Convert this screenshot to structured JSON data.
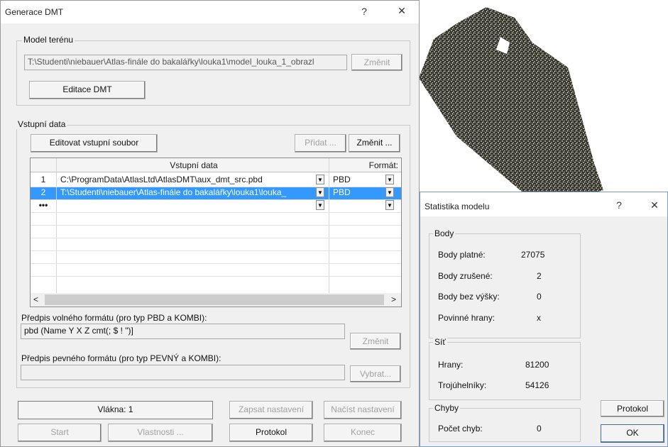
{
  "point_cloud": {
    "icon": "point-cloud-preview"
  },
  "generace": {
    "title": "Generace DMT",
    "help": "?",
    "close": "✕",
    "model_group": "Model terénu",
    "model_path": "T:\\Studenti\\niebauer\\Atlas-finále do bakalářky\\louka1\\model_louka_1_obrazl",
    "model_change": "Změnit",
    "edit_dmt": "Editace DMT",
    "input_group": "Vstupní data",
    "edit_input": "Editovat vstupní soubor",
    "add": "Přidat ...",
    "change": "Změnit ...",
    "grid": {
      "col_data": "Vstupní data",
      "col_format": "Formát:",
      "rows": [
        {
          "num": "1",
          "path": "C:\\ProgramData\\AtlasLtd\\AtlasDMT\\aux_dmt_src.pbd",
          "format": "PBD"
        },
        {
          "num": "2",
          "path": "T:\\Studenti\\niebauer\\Atlas-finále do bakalářky\\louka1\\louka_",
          "format": "PBD"
        },
        {
          "num": "•••",
          "path": "",
          "format": ""
        }
      ]
    },
    "free_format_label": "Předpis volného formátu (pro typ PBD a KOMBI):",
    "free_format_value": "pbd (Name Y X Z cmt(; $ ! \")]",
    "free_format_btn": "Změnit",
    "fixed_format_label": "Předpis pevného formátu (pro typ PEVNÝ a KOMBI):",
    "fixed_format_value": "",
    "fixed_format_btn": "Vybrat...",
    "threads": "Vlákna: 1",
    "save_settings": "Zapsat nastavení",
    "load_settings": "Načíst nastavení",
    "start": "Start",
    "properties": "Vlastnosti ...",
    "protocol": "Protokol",
    "end": "Konec"
  },
  "stats": {
    "title": "Statistika modelu",
    "help": "?",
    "close": "✕",
    "points_group": "Body",
    "valid_label": "Body platné:",
    "valid_value": "27075",
    "cancelled_label": "Body zrušené:",
    "cancelled_value": "2",
    "noheight_label": "Body bez výšky:",
    "noheight_value": "0",
    "edges_label": "Povinné hrany:",
    "edges_value": "x",
    "net_group": "Síť",
    "hrany_label": "Hrany:",
    "hrany_value": "81200",
    "tri_label": "Trojúhelníky:",
    "tri_value": "54126",
    "errors_group": "Chyby",
    "errors_label": "Počet chyb:",
    "errors_value": "0",
    "protocol": "Protokol",
    "ok": "OK"
  }
}
